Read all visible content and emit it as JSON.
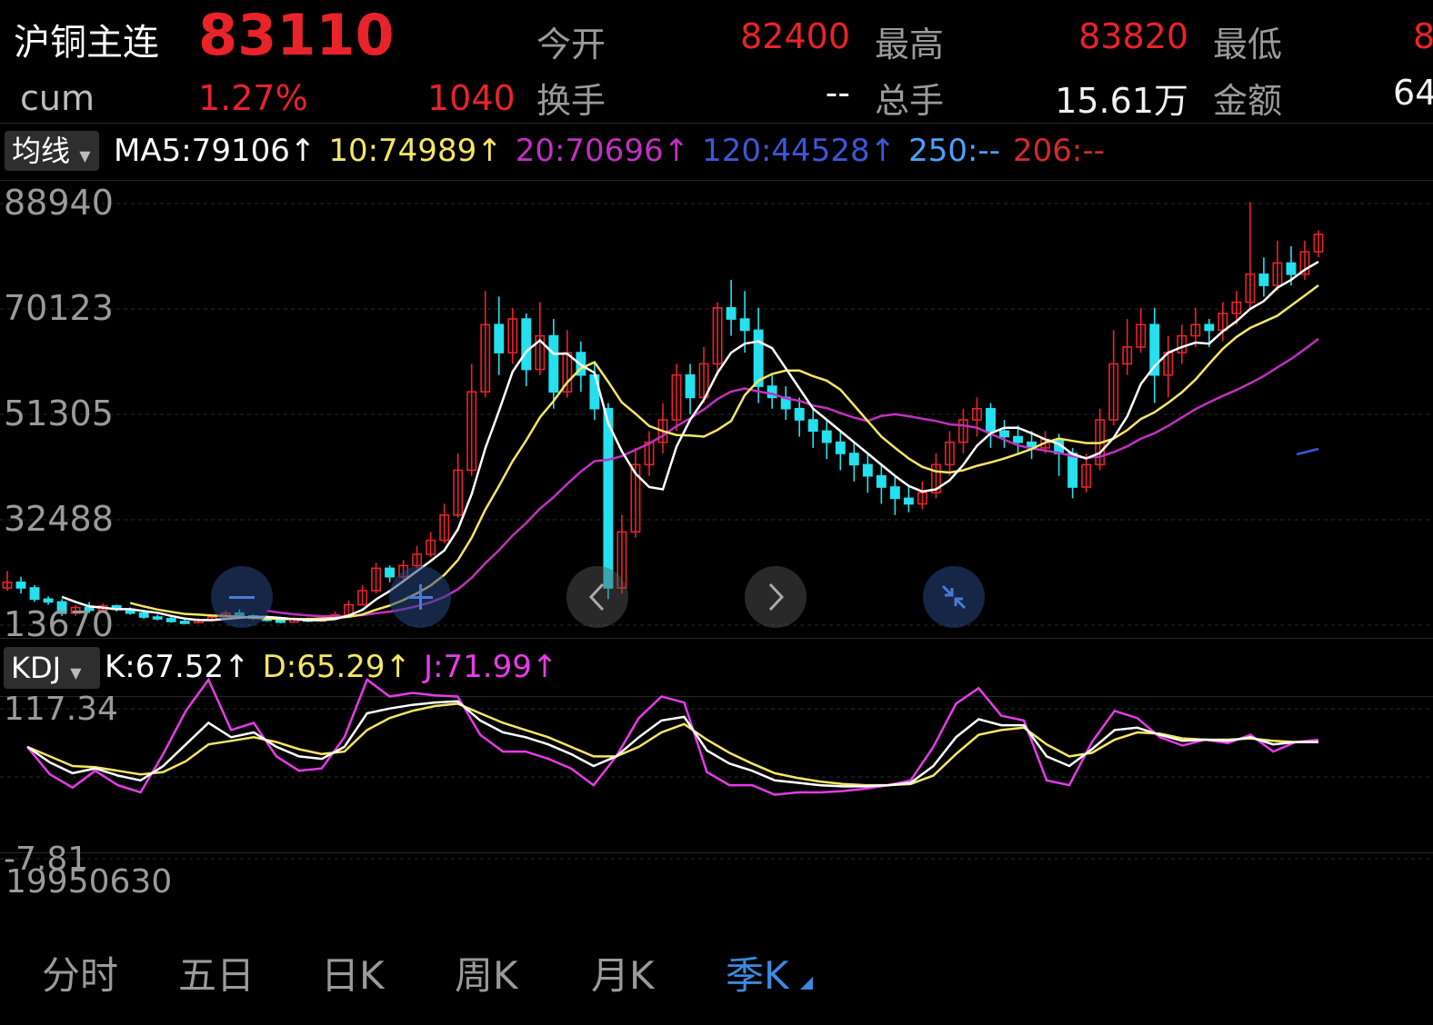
{
  "header": {
    "title": "沪铜主连",
    "price": "83110",
    "sub_label": "cum",
    "change_pct": "1.27%",
    "change_abs": "1040",
    "fields": [
      {
        "label": "今开",
        "value": "82400"
      },
      {
        "label": "最高",
        "value": "83820"
      },
      {
        "label": "最低",
        "value": "8"
      },
      {
        "label": "换手",
        "value": "--"
      },
      {
        "label": "总手",
        "value": "15.61万"
      },
      {
        "label": "金额",
        "value": "64"
      }
    ]
  },
  "ma_bar": {
    "selector": "均线",
    "items": [
      {
        "text": "MA5:79106↑",
        "color": "#ffffff"
      },
      {
        "text": "10:74989↑",
        "color": "#f5e663"
      },
      {
        "text": "20:70696↑",
        "color": "#c230c2"
      },
      {
        "text": "120:44528↑",
        "color": "#3f56d8"
      },
      {
        "text": "250:--",
        "color": "#4aa3ff"
      },
      {
        "text": "206:--",
        "color": "#d42a2a"
      }
    ]
  },
  "kdj_bar": {
    "selector": "KDJ",
    "items": [
      {
        "text": "K:67.52↑",
        "color": "#ffffff"
      },
      {
        "text": "D:65.29↑",
        "color": "#f5e663"
      },
      {
        "text": "J:71.99↑",
        "color": "#e83be8"
      }
    ]
  },
  "start_date": "19950630",
  "tabs": [
    {
      "label": "分时",
      "active": false
    },
    {
      "label": "五日",
      "active": false
    },
    {
      "label": "日K",
      "active": false
    },
    {
      "label": "周K",
      "active": false
    },
    {
      "label": "月K",
      "active": false
    },
    {
      "label": "季K",
      "active": true
    }
  ],
  "overlay_buttons": [
    "minus-icon",
    "plus-icon",
    "chevron-left-icon",
    "chevron-right-icon",
    "collapse-icon"
  ],
  "colors": {
    "up": "#e8232a",
    "down": "#25e0ee",
    "k": "#ffffff",
    "d": "#f5e663",
    "j": "#e83be8",
    "ma20": "#c230c2",
    "ma120": "#3f56d8"
  },
  "chart_data": {
    "type": "candlestick",
    "price_axis": {
      "ticks": [
        "88940",
        "70123",
        "51305",
        "32488",
        "13670"
      ],
      "ylim": [
        13670,
        88940
      ]
    },
    "kdj_axis": {
      "ticks": [
        "117.34",
        "-7.81"
      ],
      "ylim": [
        -7.81,
        117.34
      ]
    },
    "candles": [
      {
        "o": 20000,
        "c": 21000,
        "h": 23000,
        "l": 19500
      },
      {
        "o": 21000,
        "c": 20000,
        "h": 22000,
        "l": 19000
      },
      {
        "o": 20000,
        "c": 18000,
        "h": 20500,
        "l": 17500
      },
      {
        "o": 18000,
        "c": 17500,
        "h": 18500,
        "l": 17000
      },
      {
        "o": 17500,
        "c": 15500,
        "h": 18000,
        "l": 15000
      },
      {
        "o": 15500,
        "c": 16500,
        "h": 17000,
        "l": 15000
      },
      {
        "o": 16500,
        "c": 16000,
        "h": 17500,
        "l": 15500
      },
      {
        "o": 16000,
        "c": 16800,
        "h": 17200,
        "l": 15800
      },
      {
        "o": 16800,
        "c": 16200,
        "h": 17000,
        "l": 15800
      },
      {
        "o": 16200,
        "c": 15500,
        "h": 16500,
        "l": 15200
      },
      {
        "o": 15500,
        "c": 14800,
        "h": 15800,
        "l": 14500
      },
      {
        "o": 14800,
        "c": 14500,
        "h": 15200,
        "l": 14200
      },
      {
        "o": 14500,
        "c": 14000,
        "h": 14800,
        "l": 13800
      },
      {
        "o": 14000,
        "c": 13800,
        "h": 14300,
        "l": 13600
      },
      {
        "o": 13800,
        "c": 14200,
        "h": 14600,
        "l": 13700
      },
      {
        "o": 14200,
        "c": 14800,
        "h": 15200,
        "l": 14000
      },
      {
        "o": 14800,
        "c": 15500,
        "h": 16000,
        "l": 14600
      },
      {
        "o": 15500,
        "c": 15000,
        "h": 16200,
        "l": 14800
      },
      {
        "o": 15000,
        "c": 14600,
        "h": 15300,
        "l": 14300
      },
      {
        "o": 14600,
        "c": 14200,
        "h": 14900,
        "l": 14000
      },
      {
        "o": 14200,
        "c": 13900,
        "h": 14500,
        "l": 13700
      },
      {
        "o": 13900,
        "c": 14400,
        "h": 14800,
        "l": 13800
      },
      {
        "o": 14400,
        "c": 14100,
        "h": 14700,
        "l": 13900
      },
      {
        "o": 14100,
        "c": 14600,
        "h": 15000,
        "l": 14000
      },
      {
        "o": 14600,
        "c": 15200,
        "h": 15800,
        "l": 14400
      },
      {
        "o": 15200,
        "c": 17000,
        "h": 17800,
        "l": 15000
      },
      {
        "o": 17000,
        "c": 19500,
        "h": 20500,
        "l": 16800
      },
      {
        "o": 19500,
        "c": 23500,
        "h": 24500,
        "l": 19000
      },
      {
        "o": 23500,
        "c": 22000,
        "h": 24000,
        "l": 21000
      },
      {
        "o": 22000,
        "c": 24000,
        "h": 25000,
        "l": 21500
      },
      {
        "o": 24000,
        "c": 26000,
        "h": 27500,
        "l": 23500
      },
      {
        "o": 26000,
        "c": 28500,
        "h": 30000,
        "l": 25500
      },
      {
        "o": 28500,
        "c": 33000,
        "h": 35000,
        "l": 28000
      },
      {
        "o": 33000,
        "c": 41000,
        "h": 44000,
        "l": 32500
      },
      {
        "o": 41000,
        "c": 55000,
        "h": 60000,
        "l": 40000
      },
      {
        "o": 55000,
        "c": 67000,
        "h": 73000,
        "l": 54000
      },
      {
        "o": 67000,
        "c": 62000,
        "h": 72000,
        "l": 58000
      },
      {
        "o": 62000,
        "c": 68000,
        "h": 70000,
        "l": 60000
      },
      {
        "o": 68000,
        "c": 59000,
        "h": 69000,
        "l": 56000
      },
      {
        "o": 59000,
        "c": 65000,
        "h": 71000,
        "l": 58000
      },
      {
        "o": 65000,
        "c": 55000,
        "h": 68000,
        "l": 52000
      },
      {
        "o": 55000,
        "c": 62000,
        "h": 66000,
        "l": 54000
      },
      {
        "o": 62000,
        "c": 58000,
        "h": 64000,
        "l": 55000
      },
      {
        "o": 58000,
        "c": 52000,
        "h": 60000,
        "l": 50000
      },
      {
        "o": 52000,
        "c": 20000,
        "h": 53000,
        "l": 18000
      },
      {
        "o": 20000,
        "c": 30000,
        "h": 33000,
        "l": 19000
      },
      {
        "o": 30000,
        "c": 42000,
        "h": 45000,
        "l": 29000
      },
      {
        "o": 42000,
        "c": 46000,
        "h": 48000,
        "l": 40000
      },
      {
        "o": 46000,
        "c": 50000,
        "h": 53000,
        "l": 44000
      },
      {
        "o": 50000,
        "c": 58000,
        "h": 60000,
        "l": 48000
      },
      {
        "o": 58000,
        "c": 54000,
        "h": 60000,
        "l": 51000
      },
      {
        "o": 54000,
        "c": 60000,
        "h": 63000,
        "l": 53000
      },
      {
        "o": 60000,
        "c": 70000,
        "h": 71000,
        "l": 58000
      },
      {
        "o": 70000,
        "c": 68000,
        "h": 75000,
        "l": 65000
      },
      {
        "o": 68000,
        "c": 66000,
        "h": 73000,
        "l": 62000
      },
      {
        "o": 66000,
        "c": 56000,
        "h": 70000,
        "l": 53000
      },
      {
        "o": 56000,
        "c": 54000,
        "h": 58000,
        "l": 52000
      },
      {
        "o": 54000,
        "c": 52000,
        "h": 56000,
        "l": 50000
      },
      {
        "o": 52000,
        "c": 50000,
        "h": 54000,
        "l": 47000
      },
      {
        "o": 50000,
        "c": 48000,
        "h": 52000,
        "l": 45000
      },
      {
        "o": 48000,
        "c": 46000,
        "h": 50000,
        "l": 43000
      },
      {
        "o": 46000,
        "c": 44000,
        "h": 48000,
        "l": 41000
      },
      {
        "o": 44000,
        "c": 42000,
        "h": 46000,
        "l": 39000
      },
      {
        "o": 42000,
        "c": 40000,
        "h": 44000,
        "l": 37000
      },
      {
        "o": 40000,
        "c": 38000,
        "h": 42000,
        "l": 35000
      },
      {
        "o": 38000,
        "c": 36000,
        "h": 40000,
        "l": 33000
      },
      {
        "o": 36000,
        "c": 35000,
        "h": 38000,
        "l": 33500
      },
      {
        "o": 35000,
        "c": 37000,
        "h": 39000,
        "l": 34000
      },
      {
        "o": 37000,
        "c": 42000,
        "h": 44000,
        "l": 36000
      },
      {
        "o": 42000,
        "c": 46000,
        "h": 48000,
        "l": 40000
      },
      {
        "o": 46000,
        "c": 50000,
        "h": 52000,
        "l": 44000
      },
      {
        "o": 50000,
        "c": 52000,
        "h": 54000,
        "l": 47000
      },
      {
        "o": 52000,
        "c": 48000,
        "h": 53000,
        "l": 45000
      },
      {
        "o": 48000,
        "c": 47000,
        "h": 50000,
        "l": 45000
      },
      {
        "o": 47000,
        "c": 46000,
        "h": 49000,
        "l": 44000
      },
      {
        "o": 46000,
        "c": 45000,
        "h": 48000,
        "l": 43000
      },
      {
        "o": 45000,
        "c": 46500,
        "h": 48000,
        "l": 44000
      },
      {
        "o": 46500,
        "c": 44000,
        "h": 47500,
        "l": 40000
      },
      {
        "o": 44000,
        "c": 38000,
        "h": 45000,
        "l": 36000
      },
      {
        "o": 38000,
        "c": 42000,
        "h": 44000,
        "l": 37000
      },
      {
        "o": 42000,
        "c": 50000,
        "h": 52000,
        "l": 41000
      },
      {
        "o": 50000,
        "c": 60000,
        "h": 66000,
        "l": 49000
      },
      {
        "o": 60000,
        "c": 63000,
        "h": 68000,
        "l": 58000
      },
      {
        "o": 63000,
        "c": 67000,
        "h": 70000,
        "l": 62000
      },
      {
        "o": 67000,
        "c": 58000,
        "h": 70000,
        "l": 53000
      },
      {
        "o": 58000,
        "c": 62000,
        "h": 65000,
        "l": 54000
      },
      {
        "o": 62000,
        "c": 65000,
        "h": 67000,
        "l": 60000
      },
      {
        "o": 65000,
        "c": 67000,
        "h": 70000,
        "l": 63000
      },
      {
        "o": 67000,
        "c": 66000,
        "h": 68000,
        "l": 63000
      },
      {
        "o": 66000,
        "c": 69000,
        "h": 71000,
        "l": 64000
      },
      {
        "o": 69000,
        "c": 71000,
        "h": 73000,
        "l": 67000
      },
      {
        "o": 71000,
        "c": 76000,
        "h": 88900,
        "l": 70000
      },
      {
        "o": 76000,
        "c": 74000,
        "h": 79000,
        "l": 72000
      },
      {
        "o": 74000,
        "c": 78000,
        "h": 82000,
        "l": 73000
      },
      {
        "o": 78000,
        "c": 76000,
        "h": 81000,
        "l": 74000
      },
      {
        "o": 76000,
        "c": 80000,
        "h": 82000,
        "l": 75000
      },
      {
        "o": 80000,
        "c": 83110,
        "h": 83820,
        "l": 79000
      }
    ],
    "kdj": {
      "k": [
        78,
        65,
        56,
        60,
        54,
        50,
        62,
        80,
        98,
        86,
        90,
        78,
        70,
        68,
        78,
        106,
        110,
        113,
        115,
        116,
        100,
        90,
        86,
        80,
        72,
        62,
        70,
        86,
        100,
        103,
        75,
        64,
        58,
        50,
        48,
        46,
        45,
        45,
        46,
        48,
        62,
        86,
        101,
        96,
        96,
        70,
        62,
        76,
        92,
        94,
        88,
        83,
        84,
        83,
        86,
        80,
        82,
        82
      ],
      "d": [
        78,
        70,
        62,
        61,
        58,
        55,
        57,
        66,
        80,
        83,
        86,
        82,
        76,
        72,
        74,
        92,
        102,
        108,
        112,
        114,
        106,
        98,
        92,
        86,
        78,
        70,
        70,
        78,
        90,
        97,
        84,
        73,
        64,
        56,
        52,
        49,
        47,
        46,
        46,
        47,
        54,
        72,
        88,
        92,
        94,
        80,
        70,
        73,
        84,
        90,
        89,
        85,
        84,
        84,
        85,
        83,
        82,
        82
      ],
      "j": [
        78,
        55,
        44,
        58,
        46,
        40,
        72,
        108,
        134,
        92,
        98,
        70,
        58,
        60,
        86,
        134,
        120,
        123,
        121,
        120,
        88,
        74,
        74,
        68,
        60,
        46,
        70,
        102,
        120,
        115,
        57,
        46,
        46,
        38,
        40,
        40,
        41,
        43,
        46,
        50,
        78,
        114,
        127,
        104,
        100,
        50,
        46,
        82,
        108,
        102,
        86,
        79,
        84,
        81,
        88,
        74,
        82,
        84
      ]
    }
  }
}
